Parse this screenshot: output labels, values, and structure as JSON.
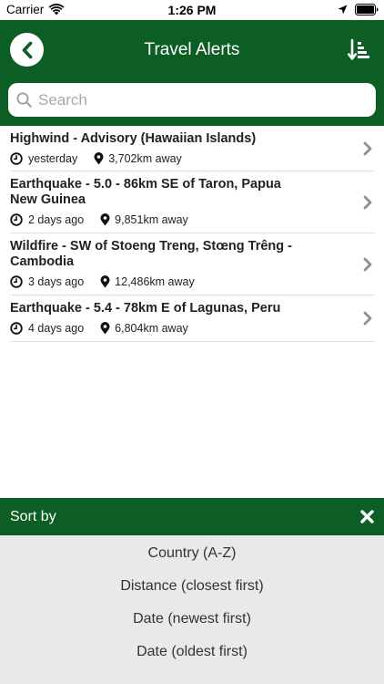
{
  "status_bar": {
    "carrier": "Carrier",
    "time": "1:26 PM",
    "icons": [
      "wifi-icon",
      "location-arrow-icon",
      "battery-icon"
    ]
  },
  "header": {
    "title": "Travel Alerts",
    "back_icon": "chevron-left-icon",
    "sort_icon": "sort-descending-icon",
    "background_color": "#0d5e24"
  },
  "search": {
    "placeholder": "Search",
    "value": ""
  },
  "alerts": [
    {
      "title": "Highwind - Advisory (Hawaiian Islands)",
      "time": "yesterday",
      "distance": "3,702km away"
    },
    {
      "title": "Earthquake - 5.0 - 86km SE of Taron, Papua New Guinea",
      "time": "2 days ago",
      "distance": "9,851km away"
    },
    {
      "title": "Wildfire - SW of Stoeng Treng, Stœng Trêng - Cambodia",
      "time": "3 days ago",
      "distance": "12,486km away"
    },
    {
      "title": "Earthquake - 5.4 - 78km E of Lagunas, Peru",
      "time": "4 days ago",
      "distance": "6,804km away"
    }
  ],
  "sort_sheet": {
    "title": "Sort by",
    "close_icon": "close-x-icon",
    "options": [
      "Country (A-Z)",
      "Distance (closest first)",
      "Date (newest first)",
      "Date (oldest first)"
    ]
  }
}
